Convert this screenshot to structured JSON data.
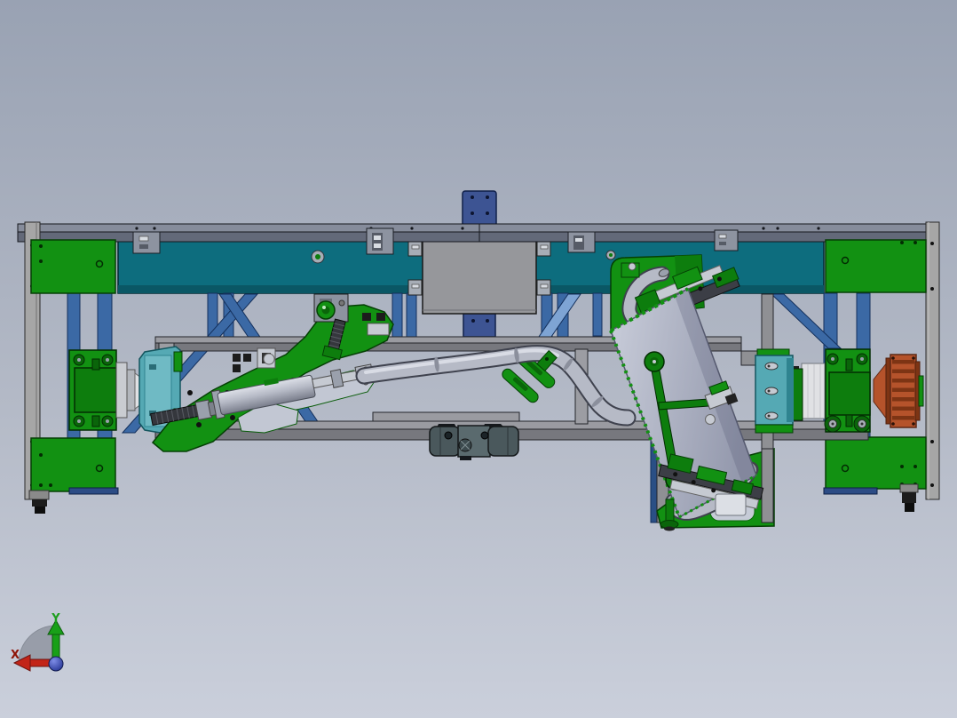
{
  "viewport": {
    "type": "3d-cad-viewport",
    "description": "CAD viewport (front view) of a tube bending/welding fixture assembly on a steel frame",
    "background": {
      "top": "#99a2b3",
      "mid": "#b3b9c6",
      "bottom": "#cacfdb"
    }
  },
  "triad": {
    "x_label": "X",
    "y_label": "Y",
    "x_color": "#c22418",
    "x_label_color": "#8e1408",
    "y_color": "#18a018",
    "y_label_color": "#1d9e1d",
    "z_color": "#2438c8"
  },
  "palette": {
    "bg-top": "#99a2b3",
    "bg-mid": "#b3b9c6",
    "bg-bottom": "#cacfdb",
    "rail-light": "#868c9b",
    "rail-dark": "#636979",
    "beam-teal": "#0d6d7e",
    "beam-teal-dark": "#0a5765",
    "beam-strip": "#b7c2d8",
    "beam-behind": "#9db0cd",
    "steel-blue": "#3b69a5",
    "steel-blue-dark": "#2a4f85",
    "steel-blue-light": "#7ea4d4",
    "green": "#129112",
    "green-mid": "#0d7d0d",
    "green-dark": "#0a650a",
    "green-edge": "#053f05",
    "frame-light": "#9a9ba1",
    "frame-dark": "#77787e",
    "post-gray": "#a6a6a6",
    "plate-gray": "#96979b",
    "clip-gray": "#8d93a0",
    "panel-light": "#c9cdda",
    "panel-dark": "#9499ad",
    "panel-edge": "#565a6e",
    "tube-fill": "#b6bac6",
    "tube-edge": "#3f424e",
    "tube-shine": "#dde0e8",
    "tube-ring": "#8b8f9c",
    "chuck-teal": "#55a9b4",
    "chuck-teal-dark": "#2f8490",
    "chuck-teal-light": "#6fbac4",
    "mount-blue": "#3d5493",
    "mount-blue-dark": "#1c2d61",
    "motor-orange": "#b5532b",
    "motor-orange-dark": "#7d3414",
    "silver": "#c6cad2",
    "silver-dark": "#9aa0ac",
    "white-part": "#e0e1e4",
    "dark-part": "#1c1c1c",
    "block-gray": "#4a585c",
    "block-gray-light": "#5a6a6e",
    "red-ring": "#b23038",
    "axis-red": "#c22418",
    "axis-green": "#18a018",
    "triad-disc": "#8d939e"
  },
  "model": {
    "visible_components": [
      "top-rail",
      "main-beam",
      "center-mount-plate",
      "top-mount-plate",
      "bottom-mount-plate",
      "left-column",
      "right-column",
      "sub-frame",
      "bottom-clamp-block",
      "left-drive-unit",
      "right-drive-unit",
      "left-chuck",
      "right-chuck",
      "left-clamp-arm",
      "pneumatic-cylinder",
      "workpiece-tube",
      "tilted-panel-fixture",
      "top-clamp-unit",
      "bottom-clamp-unit",
      "orientation-triad"
    ]
  }
}
